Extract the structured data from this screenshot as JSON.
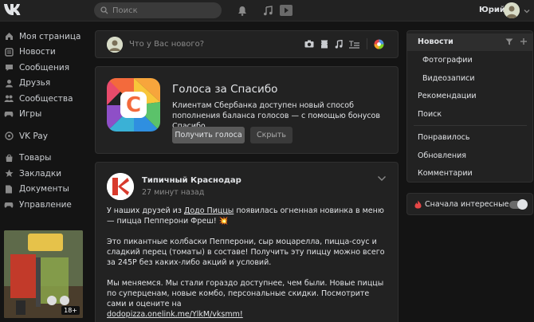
{
  "header": {
    "logo_text": "VK",
    "search_placeholder": "Поиск",
    "username": "Юрий"
  },
  "sidebar": {
    "items": [
      {
        "label": "Моя страница",
        "icon": "home-icon"
      },
      {
        "label": "Новости",
        "icon": "news-icon"
      },
      {
        "label": "Сообщения",
        "icon": "message-icon"
      },
      {
        "label": "Друзья",
        "icon": "friend-icon"
      },
      {
        "label": "Сообщества",
        "icon": "communities-icon"
      },
      {
        "label": "Игры",
        "icon": "gamepad-icon"
      },
      {
        "label": "VK Pay",
        "icon": "vkpay-icon"
      },
      {
        "label": "Товары",
        "icon": "shopping-bag-icon"
      },
      {
        "label": "Закладки",
        "icon": "star-icon"
      },
      {
        "label": "Документы",
        "icon": "document-icon"
      },
      {
        "label": "Управление",
        "icon": "gamepad-icon"
      }
    ],
    "banner_badge": "18+"
  },
  "composer": {
    "placeholder": "Что у Вас нового?"
  },
  "promo": {
    "title": "Голоса за Спасибо",
    "description": "Клиентам Сбербанка доступен новый способ пополнения баланса голосов — с помощью бонусов Спасибо.",
    "primary_button": "Получить голоса",
    "secondary_button": "Скрыть",
    "icon_letter": "С"
  },
  "post": {
    "author": "Типичный Краснодар",
    "time": "27 минут назад",
    "p1_a": "У наших друзей из ",
    "p1_link": "Додо Пиццы",
    "p1_b": " появилась огненная новинка в меню — пицца Пепперони Фреш! 💥",
    "p2": "Это пикантные колбаски Пепперони, сыр моцарелла, пицца-соус и сладкий перец (томаты) в составе! Получить эту пиццу можно всего за 245Р без каких-либо акций и условий.",
    "p3": "Мы меняемся. Мы стали гораздо доступнее, чем были. Новые пиццы по суперценам, новые комбо, персональные скидки. Посмотрите сами и оцените на",
    "p3_link": "dodopizza.onelink.me/YlkM/vksmm!"
  },
  "right_menu": {
    "items": [
      "Новости",
      "Фотографии",
      "Видеозаписи",
      "Рекомендации",
      "Поиск",
      "Понравилось",
      "Обновления",
      "Комментарии"
    ],
    "active": "Новости"
  },
  "toggle": {
    "label": "Сначала интересные",
    "on": true
  },
  "colors": {
    "background": "#141414",
    "card": "#222222",
    "text": "#e1e3e6",
    "muted": "#8a8a8a",
    "accent_flame": "#e64646"
  }
}
